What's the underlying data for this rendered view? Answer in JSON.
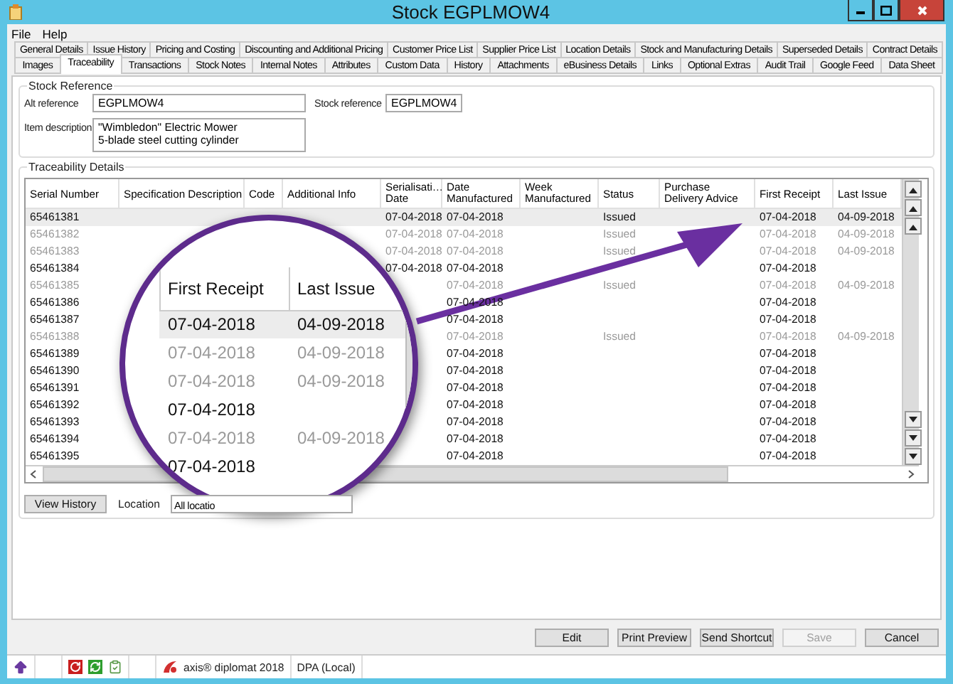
{
  "window": {
    "title": "Stock EGPLMOW4"
  },
  "menu": [
    "File",
    "Help"
  ],
  "tab_rows": [
    [
      {
        "label": "General Details",
        "selected": false
      },
      {
        "label": "Issue History",
        "selected": false
      },
      {
        "label": "Pricing and Costing",
        "selected": false
      },
      {
        "label": "Discounting and Additional Pricing",
        "selected": false
      },
      {
        "label": "Customer Price List",
        "selected": false
      },
      {
        "label": "Supplier Price List",
        "selected": false
      },
      {
        "label": "Location Details",
        "selected": false
      },
      {
        "label": "Stock and Manufacturing Details",
        "selected": false
      },
      {
        "label": "Superseded Details",
        "selected": false
      },
      {
        "label": "Contract Details",
        "selected": false
      }
    ],
    [
      {
        "label": "Images",
        "selected": false
      },
      {
        "label": "Traceability",
        "selected": true
      },
      {
        "label": "Transactions",
        "selected": false
      },
      {
        "label": "Stock Notes",
        "selected": false
      },
      {
        "label": "Internal Notes",
        "selected": false
      },
      {
        "label": "Attributes",
        "selected": false
      },
      {
        "label": "Custom Data",
        "selected": false
      },
      {
        "label": "History",
        "selected": false
      },
      {
        "label": "Attachments",
        "selected": false
      },
      {
        "label": "eBusiness Details",
        "selected": false
      },
      {
        "label": "Links",
        "selected": false
      },
      {
        "label": "Optional Extras",
        "selected": false
      },
      {
        "label": "Audit Trail",
        "selected": false
      },
      {
        "label": "Google Feed",
        "selected": false
      },
      {
        "label": "Data Sheet",
        "selected": false
      }
    ]
  ],
  "stock_reference": {
    "title": "Stock Reference",
    "alt_reference_label": "Alt reference",
    "alt_reference": "EGPLMOW4",
    "stock_reference_label": "Stock reference",
    "stock_reference": "EGPLMOW4",
    "item_description_label": "Item description",
    "item_description_lines": [
      "\"Wimbledon\" Electric Mower",
      "5-blade steel cutting cylinder"
    ]
  },
  "traceability": {
    "title": "Traceability Details",
    "columns": [
      {
        "lines": [
          "Serial Number"
        ]
      },
      {
        "lines": [
          "Specification Description"
        ]
      },
      {
        "lines": [
          "Code"
        ]
      },
      {
        "lines": [
          "Additional Info"
        ]
      },
      {
        "lines": [
          "Serialisati…",
          "Date"
        ]
      },
      {
        "lines": [
          "Date",
          "Manufactured"
        ]
      },
      {
        "lines": [
          "Week",
          "Manufactured"
        ]
      },
      {
        "lines": [
          "Status"
        ]
      },
      {
        "lines": [
          "Purchase",
          "Delivery Advice"
        ]
      },
      {
        "lines": [
          "First Receipt"
        ]
      },
      {
        "lines": [
          "Last Issue"
        ]
      }
    ],
    "rows": [
      {
        "serial_number": "65461381",
        "serialisation_date": "07-04-2018",
        "date_manufactured": "07-04-2018",
        "status": "Issued",
        "first_receipt": "07-04-2018",
        "last_issue": "04-09-2018",
        "greyed": false,
        "selected": true
      },
      {
        "serial_number": "65461382",
        "serialisation_date": "07-04-2018",
        "date_manufactured": "07-04-2018",
        "status": "Issued",
        "first_receipt": "07-04-2018",
        "last_issue": "04-09-2018",
        "greyed": true,
        "selected": false
      },
      {
        "serial_number": "65461383",
        "serialisation_date": "07-04-2018",
        "date_manufactured": "07-04-2018",
        "status": "Issued",
        "first_receipt": "07-04-2018",
        "last_issue": "04-09-2018",
        "greyed": true,
        "selected": false
      },
      {
        "serial_number": "65461384",
        "serialisation_date": "07-04-2018",
        "date_manufactured": "07-04-2018",
        "first_receipt": "07-04-2018",
        "greyed": false,
        "selected": false
      },
      {
        "serial_number": "65461385",
        "date_manufactured": "07-04-2018",
        "status": "Issued",
        "first_receipt": "07-04-2018",
        "last_issue": "04-09-2018",
        "greyed": true,
        "selected": false
      },
      {
        "serial_number": "65461386",
        "date_manufactured": "07-04-2018",
        "first_receipt": "07-04-2018",
        "greyed": false,
        "selected": false
      },
      {
        "serial_number": "65461387",
        "date_manufactured": "07-04-2018",
        "first_receipt": "07-04-2018",
        "greyed": false,
        "selected": false
      },
      {
        "serial_number": "65461388",
        "date_manufactured": "07-04-2018",
        "status": "Issued",
        "first_receipt": "07-04-2018",
        "last_issue": "04-09-2018",
        "greyed": true,
        "selected": false
      },
      {
        "serial_number": "65461389",
        "date_manufactured": "07-04-2018",
        "first_receipt": "07-04-2018",
        "greyed": false,
        "selected": false
      },
      {
        "serial_number": "65461390",
        "date_manufactured": "07-04-2018",
        "first_receipt": "07-04-2018",
        "greyed": false,
        "selected": false
      },
      {
        "serial_number": "65461391",
        "date_manufactured": "07-04-2018",
        "first_receipt": "07-04-2018",
        "greyed": false,
        "selected": false
      },
      {
        "serial_number": "65461392",
        "date_manufactured": "07-04-2018",
        "first_receipt": "07-04-2018",
        "greyed": false,
        "selected": false
      },
      {
        "serial_number": "65461393",
        "date_manufactured": "07-04-2018",
        "first_receipt": "07-04-2018",
        "greyed": false,
        "selected": false
      },
      {
        "serial_number": "65461394",
        "date_manufactured": "07-04-2018",
        "first_receipt": "07-04-2018",
        "greyed": false,
        "selected": false
      },
      {
        "serial_number": "65461395",
        "date_manufactured": "07-04-2018",
        "first_receipt": "07-04-2018",
        "greyed": false,
        "selected": false
      }
    ],
    "view_history": "View History",
    "location_label": "Location",
    "location_value": "All locatio"
  },
  "magnifier": {
    "columns": [
      "First Receipt",
      "Last Issue"
    ],
    "rows": [
      {
        "first_receipt": "07-04-2018",
        "last_issue": "04-09-2018",
        "greyed": false,
        "selected": true
      },
      {
        "first_receipt": "07-04-2018",
        "last_issue": "04-09-2018",
        "greyed": true,
        "selected": false
      },
      {
        "first_receipt": "07-04-2018",
        "last_issue": "04-09-2018",
        "greyed": true,
        "selected": false
      },
      {
        "first_receipt": "07-04-2018",
        "greyed": false,
        "selected": false
      },
      {
        "first_receipt": "07-04-2018",
        "last_issue": "04-09-2018",
        "greyed": true,
        "selected": false
      },
      {
        "first_receipt": "07-04-2018",
        "greyed": false,
        "selected": false
      }
    ]
  },
  "buttons": [
    {
      "label": "Edit",
      "disabled": false
    },
    {
      "label": "Print Preview",
      "disabled": false
    },
    {
      "label": "Send Shortcut",
      "disabled": false
    },
    {
      "label": "Save",
      "disabled": true
    },
    {
      "label": "Cancel",
      "disabled": false
    }
  ],
  "status_bar": {
    "product": "axis® diplomat 2018",
    "database": "DPA (Local)"
  }
}
